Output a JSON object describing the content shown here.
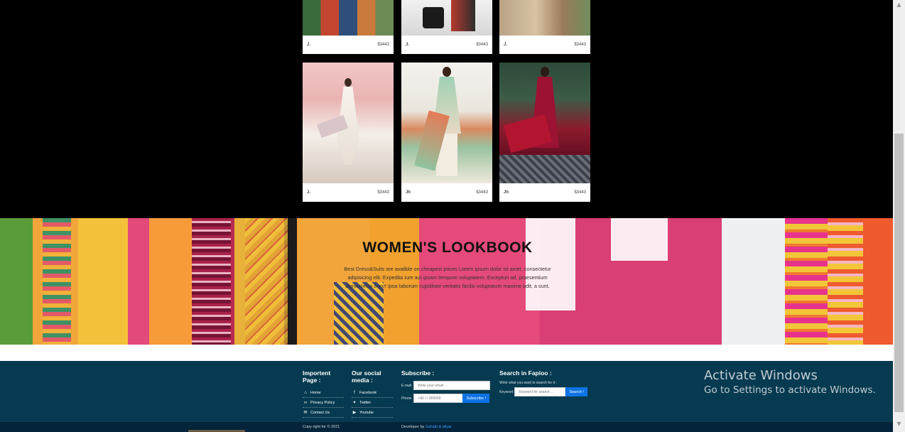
{
  "products": {
    "row1": [
      {
        "name": "J.",
        "price": "$3443"
      },
      {
        "name": "J.",
        "price": "$3443"
      },
      {
        "name": "J.",
        "price": "$3443"
      }
    ],
    "row2": [
      {
        "name": "J.",
        "price": "$3443"
      },
      {
        "name": "Jh",
        "price": "$3443"
      },
      {
        "name": "Jh",
        "price": "$3443"
      }
    ]
  },
  "lookbook": {
    "title": "WOMEN'S LOOKBOOK",
    "text": "Best Dress&Suits are avalible on cheapest prices Lorem ipsum dolor sit amet, consectetur adipisicing elit. Expedita iure aut ipsam tempore voluptatem. Excepturi ad, praesentium dignissimos error! Ipsa laborum cupiditate veritatis facilis voluptatum maxime odit, a sunt."
  },
  "footer": {
    "important": {
      "title": "Importent Page :",
      "links": [
        "Home",
        "Privacy Policy",
        "Contact Us"
      ]
    },
    "social": {
      "title": "Our social media :",
      "links": [
        "Facebook",
        "Twitter",
        "Youtube"
      ]
    },
    "subscribe": {
      "title": "Subscribe :",
      "email_label": "E-mail",
      "email_placeholder": "Write your email ...",
      "phone_label": "Phone",
      "phone_placeholder": "+96 / / 000000",
      "button": "Subscribe !"
    },
    "search": {
      "title": "Search in Faploo :",
      "hint": "Write what you want to search for it :",
      "keyword_label": "Keyword",
      "placeholder": "Keyword for search ...",
      "button": "Search !"
    },
    "copyright": "Copy right for © 2021",
    "developer_prefix": "Developer by",
    "developer_name": "Suhaib & aliyar ."
  },
  "windows": {
    "line1": "Activate Windows",
    "line2": "Go to Settings to activate Windows."
  },
  "colors": {
    "footer_bg": "#053a50",
    "button": "#0d73e6"
  }
}
